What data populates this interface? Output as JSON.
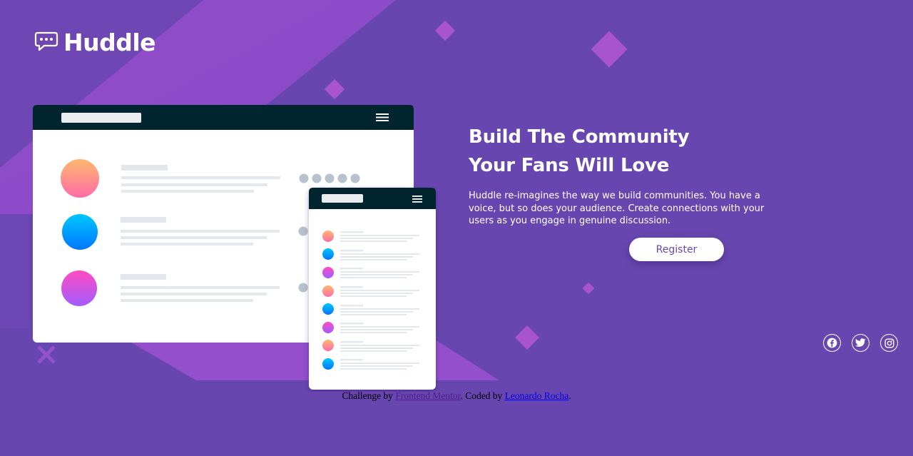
{
  "brand": {
    "name": "Huddle",
    "logo_icon": "chat-bubble-icon"
  },
  "hero": {
    "title": "Build The Community Your Fans Will Love",
    "description": "Huddle re-imagines the way we build communities. You have a voice, but so does your audience. Create connections with your users as you engage in genuine discussion.",
    "register_label": "Register"
  },
  "social": [
    {
      "name": "facebook-icon"
    },
    {
      "name": "twitter-icon"
    },
    {
      "name": "instagram-icon"
    }
  ],
  "footer": {
    "prefix": "Challenge by ",
    "link1": "Frontend Mentor",
    "middle": ". Coded by ",
    "link2": "Leonardo Rocha",
    "suffix": "."
  },
  "colors": {
    "background": "#6846b0",
    "accent_magenta": "#c74fd4",
    "dark_navy": "#00252e",
    "white": "#ffffff",
    "visited_link": "#551a8b",
    "link": "#0000ee"
  }
}
